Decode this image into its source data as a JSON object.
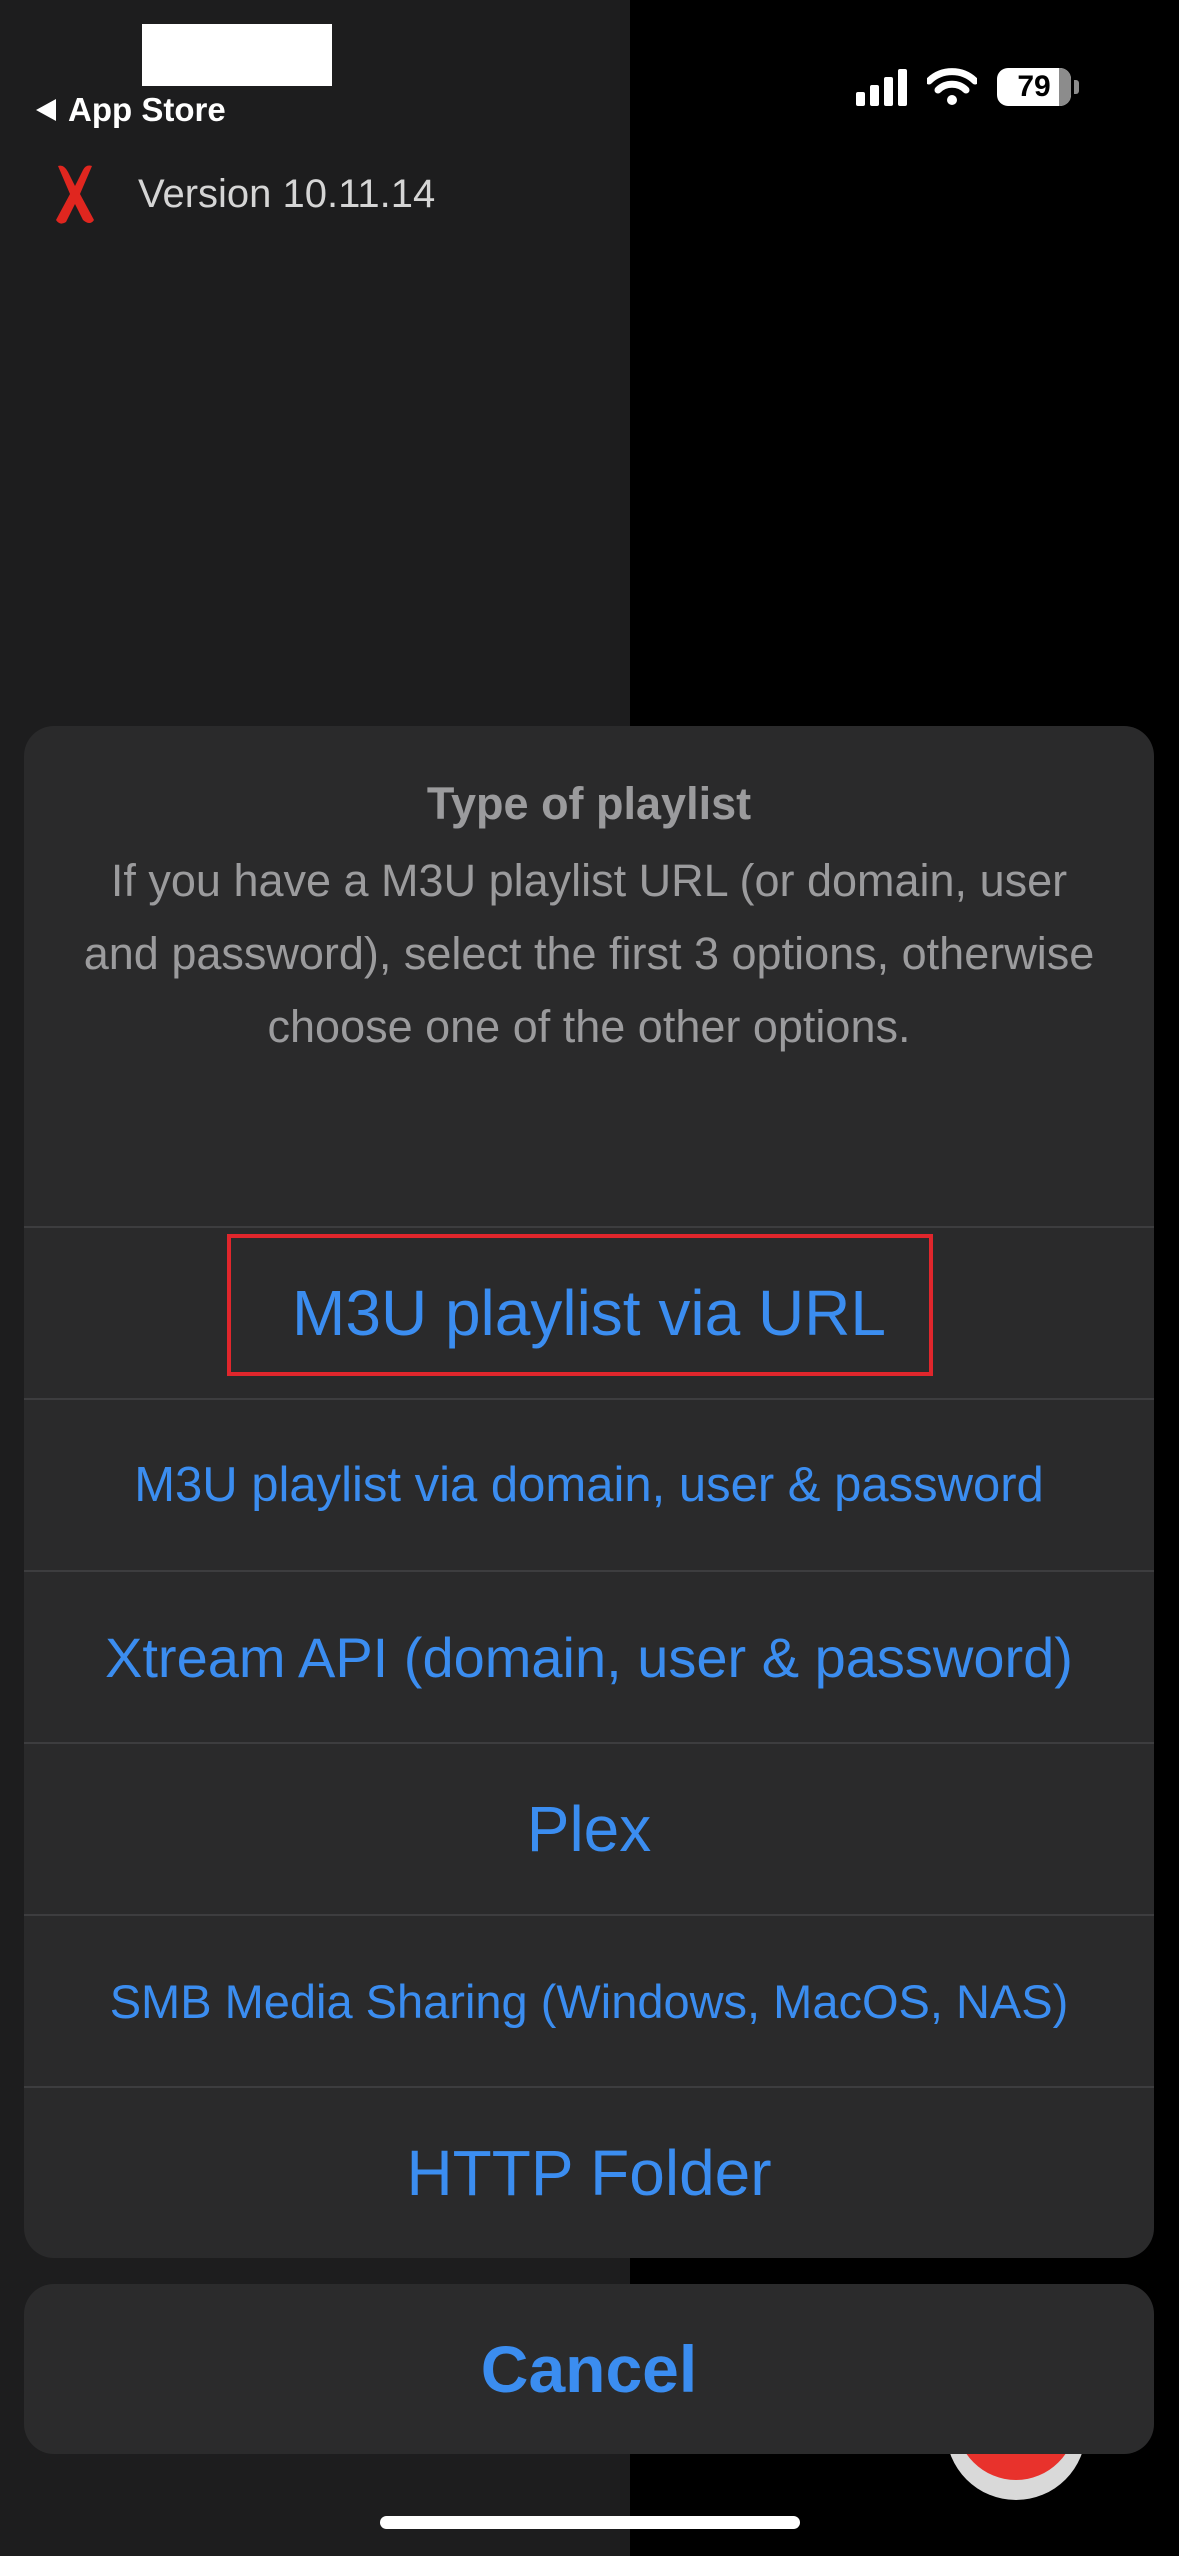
{
  "status_bar": {
    "back_label": "App Store",
    "battery_level": "79"
  },
  "background_app": {
    "version_label": "Version 10.11.14"
  },
  "action_sheet": {
    "title": "Type of playlist",
    "message": "If you have a M3U playlist URL (or domain, user and password), select the first 3 options, otherwise choose one of the other options.",
    "options": [
      {
        "label": "M3U playlist via URL",
        "highlighted": true
      },
      {
        "label": "M3U playlist via domain, user & password"
      },
      {
        "label": "Xtream API (domain, user & password)"
      },
      {
        "label": "Plex"
      },
      {
        "label": "SMB Media Sharing (Windows, MacOS, NAS)"
      },
      {
        "label": "HTTP Folder"
      }
    ],
    "cancel_label": "Cancel"
  },
  "colors": {
    "accent_blue": "#3b8df0",
    "highlight_red": "#e0262c",
    "sheet_background": "#2a2a2b"
  },
  "icons": {
    "back": "back-arrow-icon",
    "cellular": "cellular-signal-icon",
    "wifi": "wifi-icon",
    "battery": "battery-icon",
    "app_logo": "app-logo-x-icon"
  }
}
